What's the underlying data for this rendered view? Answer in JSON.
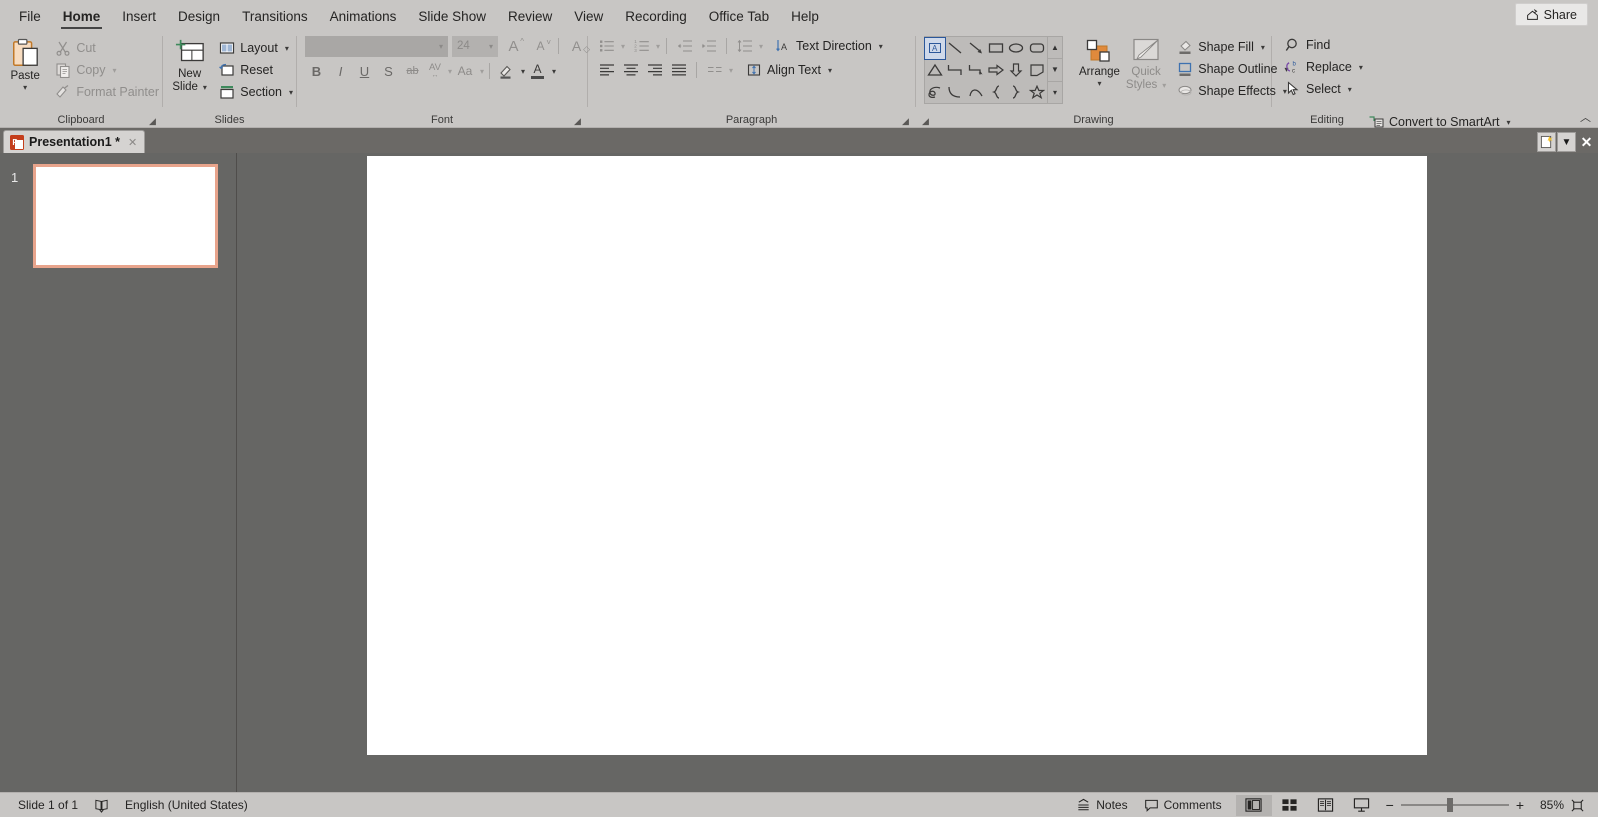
{
  "window": {
    "share_label": "Share",
    "collapse_ribbon_icon": "chevron-up"
  },
  "menu_tabs": [
    {
      "label": "File",
      "active": false
    },
    {
      "label": "Home",
      "active": true
    },
    {
      "label": "Insert",
      "active": false
    },
    {
      "label": "Design",
      "active": false
    },
    {
      "label": "Transitions",
      "active": false
    },
    {
      "label": "Animations",
      "active": false
    },
    {
      "label": "Slide Show",
      "active": false
    },
    {
      "label": "Review",
      "active": false
    },
    {
      "label": "View",
      "active": false
    },
    {
      "label": "Recording",
      "active": false
    },
    {
      "label": "Office Tab",
      "active": false
    },
    {
      "label": "Help",
      "active": false
    }
  ],
  "ribbon": {
    "clipboard": {
      "group_label": "Clipboard",
      "paste_label": "Paste",
      "cut_label": "Cut",
      "copy_label": "Copy",
      "format_painter_label": "Format Painter"
    },
    "slides": {
      "group_label": "Slides",
      "new_slide_line1": "New",
      "new_slide_line2": "Slide",
      "layout_label": "Layout",
      "reset_label": "Reset",
      "section_label": "Section"
    },
    "font": {
      "group_label": "Font",
      "font_name_value": "",
      "font_size_value": "24",
      "increase_font_label": "A",
      "decrease_font_label": "A",
      "clear_formatting_label": "A",
      "bold_label": "B",
      "italic_label": "I",
      "underline_label": "U",
      "shadow_label": "S",
      "strikethrough_label": "ab",
      "character_spacing_label": "AV",
      "change_case_label": "Aa"
    },
    "paragraph": {
      "group_label": "Paragraph",
      "text_direction_label": "Text Direction",
      "align_text_label": "Align Text",
      "convert_smartart_label": "Convert to SmartArt"
    },
    "drawing": {
      "group_label": "Drawing",
      "arrange_label": "Arrange",
      "quick_styles_line1": "Quick",
      "quick_styles_line2": "Styles",
      "shape_fill_label": "Shape Fill",
      "shape_outline_label": "Shape Outline",
      "shape_effects_label": "Shape Effects",
      "shapes": [
        "textbox-shape",
        "line-shape",
        "arrow-line-shape",
        "rectangle-shape",
        "oval-shape",
        "rounded-rectangle-shape",
        "triangle-shape",
        "elbow-connector-shape",
        "elbow-arrow-connector-shape",
        "right-arrow-shape",
        "down-arrow-shape",
        "pentagon-shape",
        "scribble-shape",
        "curve-shape",
        "arc-shape",
        "left-brace-shape",
        "right-brace-shape",
        "star-shape"
      ]
    },
    "editing": {
      "group_label": "Editing",
      "find_label": "Find",
      "replace_label": "Replace",
      "select_label": "Select"
    }
  },
  "office_tab_bar": {
    "tabs": [
      {
        "title": "Presentation1 *",
        "active": true
      }
    ],
    "new_tab_icon": "new-document-icon",
    "dropdown_icon": "chevron-down-icon",
    "close_icon": "close-icon"
  },
  "thumbnails": {
    "slides": [
      {
        "number": "1",
        "selected": true
      }
    ]
  },
  "status_bar": {
    "slide_count_label": "Slide 1 of 1",
    "accessibility_icon": "accessibility-checker-icon",
    "language_label": "English (United States)",
    "notes_label": "Notes",
    "comments_label": "Comments",
    "views": [
      {
        "name": "normal-view",
        "active": true
      },
      {
        "name": "slide-sorter-view",
        "active": false
      },
      {
        "name": "reading-view",
        "active": false
      },
      {
        "name": "slide-show-view",
        "active": false
      }
    ],
    "zoom_out_label": "−",
    "zoom_in_label": "+",
    "zoom_level": "85%",
    "fit_slide_icon": "fit-to-window-icon"
  },
  "colors": {
    "ribbon_bg": "#c8c6c4",
    "workspace_bg": "#666664",
    "tabbar_bg": "#6b6966",
    "thumbnail_selected_border": "#e8a48c",
    "ppt_accent": "#c43e1c"
  }
}
